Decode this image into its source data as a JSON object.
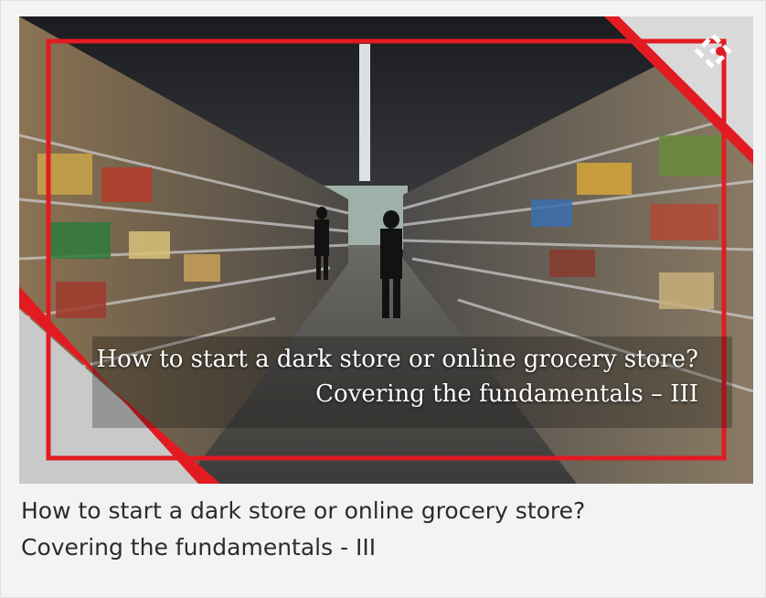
{
  "article": {
    "overlay_title_line1": "How to start a dark store or online grocery store?",
    "overlay_title_line2": "Covering the fundamentals – III",
    "caption_line1": "How to start a dark store or online grocery store?",
    "caption_line2": "Covering the fundamentals - III"
  },
  "colors": {
    "accent_red": "#e21b22",
    "frame_gray": "#c9c9c9",
    "caption_text": "#2b2b2b",
    "background": "#f3f3f3"
  },
  "icons": {
    "brand_logo": "diamond-dots-logo-icon"
  }
}
